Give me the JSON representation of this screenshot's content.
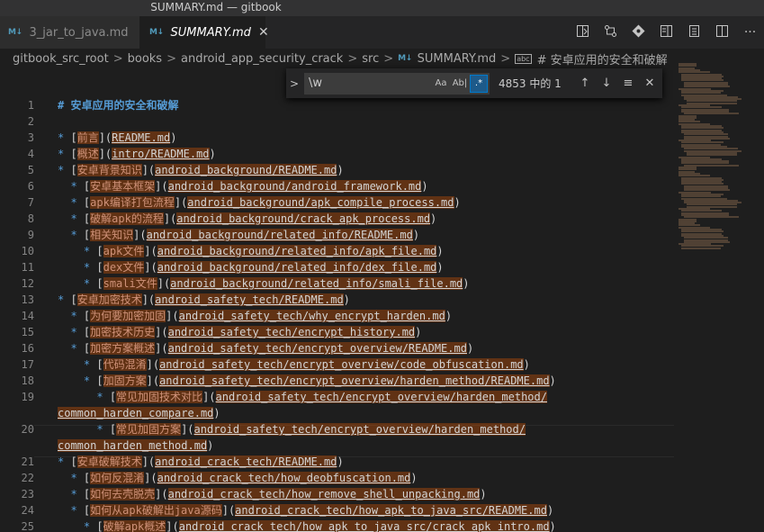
{
  "window": {
    "title": "SUMMARY.md — gitbook"
  },
  "tabs": [
    {
      "icon": "M↓",
      "label": "3_jar_to_java.md"
    },
    {
      "icon": "M↓",
      "label": "SUMMARY.md",
      "close": "✕"
    }
  ],
  "tab_actions": [
    "open-preview-icon",
    "git-compare-icon",
    "git-commit-icon",
    "preview-side-icon",
    "open-changes-icon",
    "split-editor-icon",
    "more-actions-icon"
  ],
  "breadcrumb": {
    "items": [
      "gitbook_src_root",
      "books",
      "android_app_security_crack",
      "src"
    ],
    "file": "SUMMARY.md",
    "symbol": "# 安卓应用的安全和破解",
    "separator": ">"
  },
  "find": {
    "toggle": ">",
    "query": "\\w",
    "case_label": "Aa",
    "word_label": "Ab|",
    "regex_label": ".*",
    "regex_enabled": true,
    "result": "4853 中的 1",
    "prev": "↑",
    "next": "↓",
    "selection": "≡",
    "close": "✕"
  },
  "lines": [
    {
      "n": "1",
      "indent": 0,
      "kind": "heading",
      "marker": "#",
      "text": "安卓应用的安全和破解"
    },
    {
      "n": "2",
      "indent": 0,
      "kind": "blank"
    },
    {
      "n": "3",
      "indent": 0,
      "kind": "item",
      "text": "前言",
      "link": "README.md"
    },
    {
      "n": "4",
      "indent": 0,
      "kind": "item",
      "text": "概述",
      "link": "intro/README.md"
    },
    {
      "n": "5",
      "indent": 0,
      "kind": "item",
      "text": "安卓背景知识",
      "link": "android_background/README.md"
    },
    {
      "n": "6",
      "indent": 1,
      "kind": "item",
      "text": "安卓基本框架",
      "link": "android_background/android_framework.md"
    },
    {
      "n": "7",
      "indent": 1,
      "kind": "item",
      "text": "apk编译打包流程",
      "link": "android_background/apk_compile_process.md"
    },
    {
      "n": "8",
      "indent": 1,
      "kind": "item",
      "text": "破解apk的流程",
      "link": "android_background/crack_apk_process.md"
    },
    {
      "n": "9",
      "indent": 1,
      "kind": "item",
      "text": "相关知识",
      "link": "android_background/related_info/README.md"
    },
    {
      "n": "10",
      "indent": 2,
      "kind": "item",
      "text": "apk文件",
      "link": "android_background/related_info/apk_file.md"
    },
    {
      "n": "11",
      "indent": 2,
      "kind": "item",
      "text": "dex文件",
      "link": "android_background/related_info/dex_file.md"
    },
    {
      "n": "12",
      "indent": 2,
      "kind": "item",
      "text": "smali文件",
      "link": "android_background/related_info/smali_file.md"
    },
    {
      "n": "13",
      "indent": 0,
      "kind": "item",
      "text": "安卓加密技术",
      "link": "android_safety_tech/README.md"
    },
    {
      "n": "14",
      "indent": 1,
      "kind": "item",
      "text": "为何要加密加固",
      "link": "android_safety_tech/why_encrypt_harden.md"
    },
    {
      "n": "15",
      "indent": 1,
      "kind": "item",
      "text": "加密技术历史",
      "link": "android_safety_tech/encrypt_history.md"
    },
    {
      "n": "16",
      "indent": 1,
      "kind": "item",
      "text": "加密方案概述",
      "link": "android_safety_tech/encrypt_overview/README.md"
    },
    {
      "n": "17",
      "indent": 2,
      "kind": "item",
      "text": "代码混淆",
      "link": "android_safety_tech/encrypt_overview/code_obfuscation.md"
    },
    {
      "n": "18",
      "indent": 2,
      "kind": "item",
      "text": "加固方案",
      "link": "android_safety_tech/encrypt_overview/harden_method/README.md"
    },
    {
      "n": "19",
      "indent": 3,
      "kind": "wrap",
      "text": "常见加固技术对比",
      "link": "android_safety_tech/encrypt_overview/harden_method/",
      "link2": "common_harden_compare.md"
    },
    {
      "n": "20",
      "indent": 3,
      "kind": "wrap",
      "text": "常见加固方案",
      "link": "android_safety_tech/encrypt_overview/harden_method/",
      "link2": "common_harden_method.md"
    },
    {
      "n": "21",
      "indent": 0,
      "kind": "item",
      "text": "安卓破解技术",
      "link": "android_crack_tech/README.md"
    },
    {
      "n": "22",
      "indent": 1,
      "kind": "item",
      "text": "如何反混淆",
      "link": "android_crack_tech/how_deobfuscation.md"
    },
    {
      "n": "23",
      "indent": 1,
      "kind": "item",
      "text": "如何去壳脱壳",
      "link": "android_crack_tech/how_remove_shell_unpacking.md"
    },
    {
      "n": "24",
      "indent": 1,
      "kind": "item",
      "text": "如何从apk破解出java源码",
      "link": "android_crack_tech/how_apk_to_java_src/README.md"
    },
    {
      "n": "25",
      "indent": 2,
      "kind": "item",
      "text": "破解apk概述",
      "link": "android_crack_tech/how_apk_to_java_src/crack_apk_intro.md"
    }
  ],
  "colors": {
    "background": "#1e1e1e",
    "markdown_marker": "#569cd6",
    "link_text": "#ce9178",
    "find_match": "#ea5c00",
    "regex_toggle": "#007acc"
  }
}
